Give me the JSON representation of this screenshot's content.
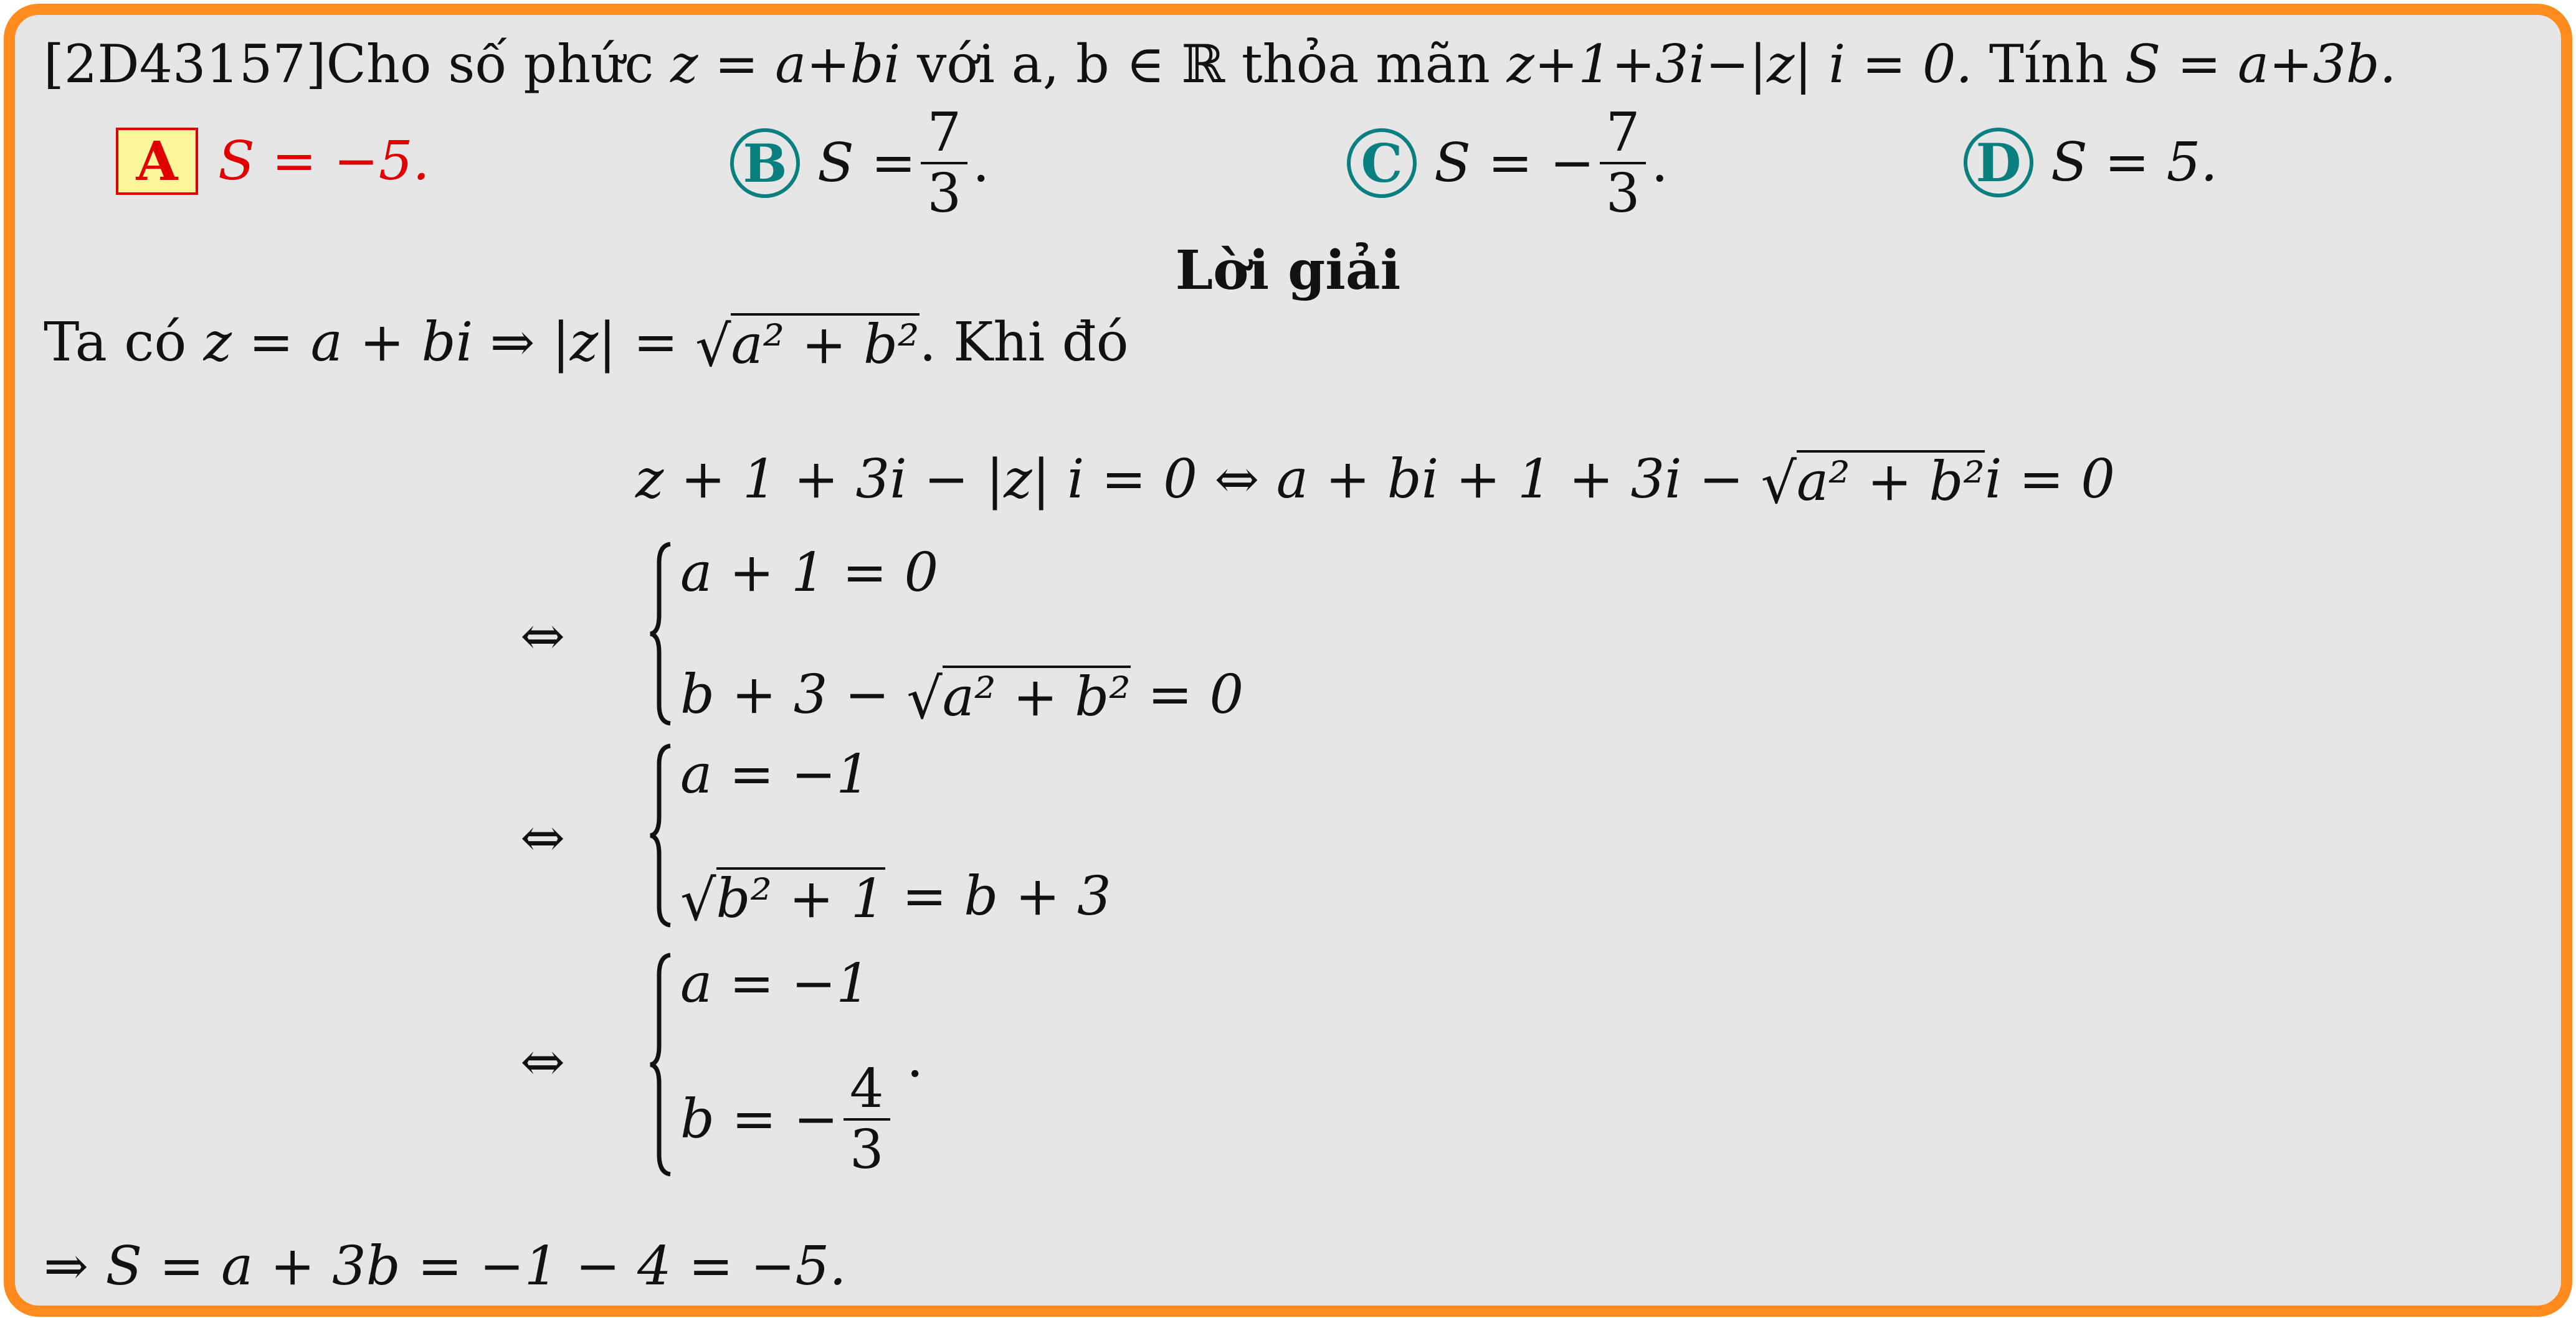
{
  "problem": {
    "id": "[2D43157]",
    "lead": "Cho số phức",
    "z_def": "z = a+bi",
    "cond_intro": "với a, b ∈ ℝ thỏa mãn",
    "equation": "z+1+3i−|z| i = 0.",
    "ask": "Tính",
    "target": "S = a+3b."
  },
  "options": [
    {
      "letter": "A",
      "text": "S = −5.",
      "correct": true
    },
    {
      "letter": "B",
      "prefix": "S =",
      "num": "7",
      "den": "3",
      "suffix": "."
    },
    {
      "letter": "C",
      "prefix": "S = −",
      "num": "7",
      "den": "3",
      "suffix": "."
    },
    {
      "letter": "D",
      "text": "S = 5."
    }
  ],
  "solution": {
    "heading": "Lời giải",
    "intro_a": "Ta có",
    "intro_b": "z = a + bi ⇒ |z| =",
    "intro_rad": "a² + b²",
    "intro_end": ". Khi đó",
    "eq1_left": "z + 1 + 3i − |z| i = 0 ⇔ a + bi + 1 + 3i −",
    "eq1_rad": "a² + b²",
    "eq1_right": "i = 0",
    "equiv": "⇔",
    "sys1_l1": "a + 1 = 0",
    "sys1_l2_a": "b + 3 −",
    "sys1_l2_rad": "a² + b²",
    "sys1_l2_b": "= 0",
    "sys2_l1": "a = −1",
    "sys2_l2_rad": "b² + 1",
    "sys2_l2_b": "= b + 3",
    "sys3_l1": "a = −1",
    "sys3_l2_a": "b = −",
    "sys3_l2_num": "4",
    "sys3_l2_den": "3",
    "sys3_dot": ".",
    "final": "⇒ S = a + 3b = −1 − 4 = −5."
  }
}
